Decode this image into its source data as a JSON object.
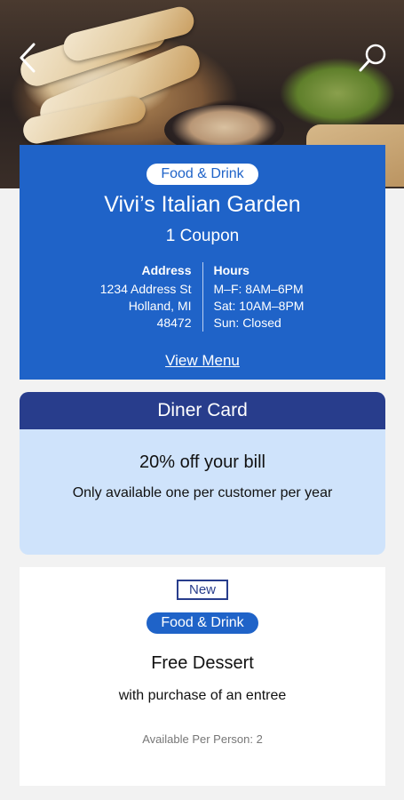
{
  "header": {
    "back_icon": "chevron-left-icon",
    "search_icon": "search-icon"
  },
  "restaurant": {
    "category": "Food & Drink",
    "name": "Vivi’s Italian Garden",
    "coupon_count": "1 Coupon",
    "address_title": "Address",
    "address_line1": "1234 Address St",
    "address_line2": "Holland, MI",
    "address_line3": "48472",
    "hours_title": "Hours",
    "hours_line1": "M–F: 8AM–6PM",
    "hours_line2": "Sat: 10AM–8PM",
    "hours_line3": "Sun: Closed",
    "view_menu_label": "View Menu"
  },
  "diner_card": {
    "title": "Diner Card",
    "offer": "20% off your bill",
    "note": "Only available one per customer per year"
  },
  "deal": {
    "badge": "New",
    "category": "Food & Drink",
    "title": "Free Dessert",
    "subtitle": "with purchase of an entree",
    "availability": "Available Per Person: 2"
  },
  "colors": {
    "primary_blue": "#1f63c8",
    "navy": "#283d8c",
    "light_blue": "#cfe3fb",
    "background": "#f2f2f2"
  }
}
